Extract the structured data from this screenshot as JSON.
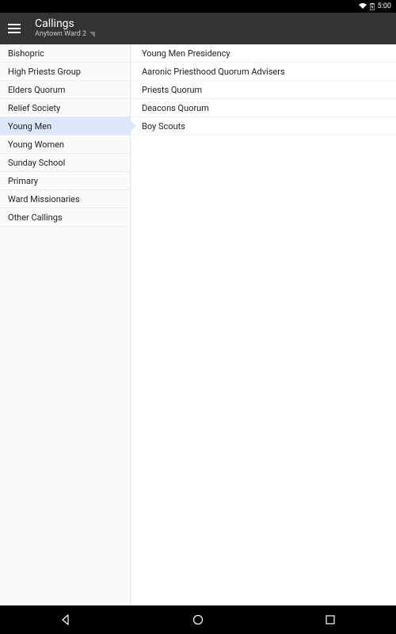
{
  "status": {
    "time": "5:00"
  },
  "header": {
    "title": "Callings",
    "subtitle": "Anytown Ward 2"
  },
  "sidebar": {
    "items": [
      {
        "label": "Bishopric",
        "selected": false
      },
      {
        "label": "High Priests Group",
        "selected": false
      },
      {
        "label": "Elders Quorum",
        "selected": false
      },
      {
        "label": "Relief Society",
        "selected": false
      },
      {
        "label": "Young Men",
        "selected": true
      },
      {
        "label": "Young Women",
        "selected": false
      },
      {
        "label": "Sunday School",
        "selected": false
      },
      {
        "label": "Primary",
        "selected": false
      },
      {
        "label": "Ward Missionaries",
        "selected": false
      },
      {
        "label": "Other Callings",
        "selected": false
      }
    ]
  },
  "detail": {
    "items": [
      {
        "label": "Young Men Presidency"
      },
      {
        "label": "Aaronic Priesthood Quorum Advisers"
      },
      {
        "label": "Priests Quorum"
      },
      {
        "label": "Deacons Quorum"
      },
      {
        "label": "Boy Scouts"
      }
    ]
  }
}
